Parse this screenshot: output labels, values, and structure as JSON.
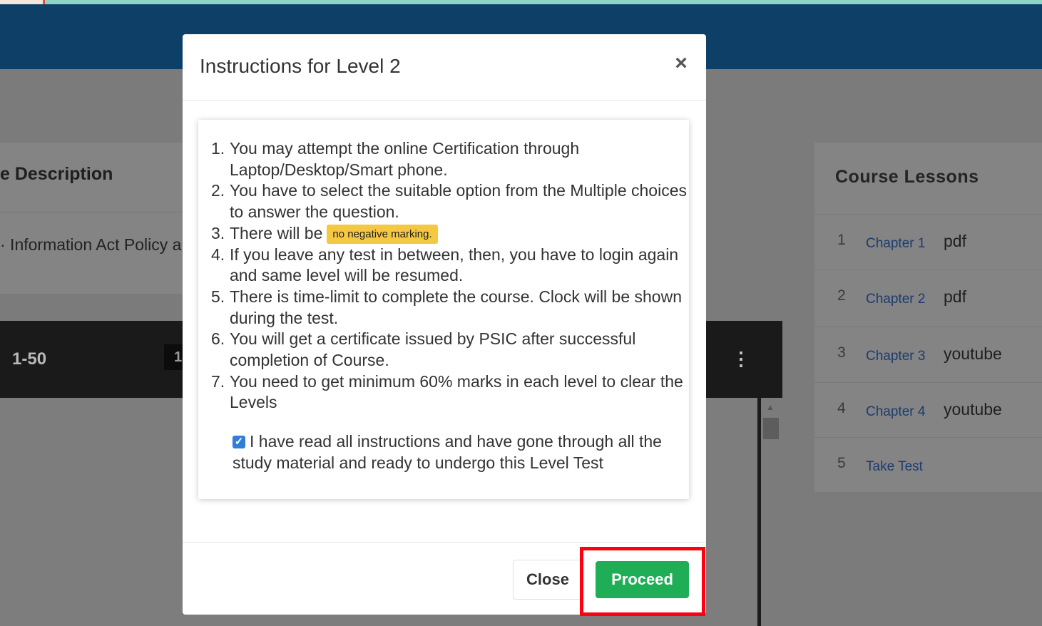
{
  "background": {
    "description_card": {
      "heading": "e Description",
      "text": "· Information Act Policy a"
    },
    "video_bar": {
      "range": "1-50",
      "pill": "1"
    },
    "lessons": {
      "heading": "Course Lessons",
      "items": [
        {
          "num": "1",
          "link": "Chapter 1",
          "type": "pdf"
        },
        {
          "num": "2",
          "link": "Chapter 2",
          "type": "pdf"
        },
        {
          "num": "3",
          "link": "Chapter 3",
          "type": "youtube"
        },
        {
          "num": "4",
          "link": "Chapter 4",
          "type": "youtube"
        },
        {
          "num": "5",
          "link": "Take Test",
          "type": ""
        }
      ]
    }
  },
  "modal": {
    "title": "Instructions for Level 2",
    "close_symbol": "×",
    "instructions": [
      {
        "num": "1.",
        "text": "You may attempt the online Certification through Laptop/Desktop/Smart phone."
      },
      {
        "num": "2.",
        "text": "You have to select the suitable option from the Multiple choices to answer the question."
      },
      {
        "num": "3.",
        "text": "There will be",
        "badge": "no negative marking."
      },
      {
        "num": "4.",
        "text": "If you leave any test in between, then, you have to login again and same level will be resumed."
      },
      {
        "num": "5.",
        "text": "There is time-limit to complete the course. Clock will be shown during the test."
      },
      {
        "num": "6.",
        "text": "You will get a certificate issued by PSIC after successful completion of Course."
      },
      {
        "num": "7.",
        "text": "You need to get minimum 60% marks in each level to clear the Levels"
      }
    ],
    "agreement": {
      "checked": true,
      "text": "I have read all instructions and have gone through all the study material and ready to undergo this Level Test"
    },
    "buttons": {
      "close": "Close",
      "proceed": "Proceed"
    }
  },
  "colors": {
    "navbar": "#0e3f66",
    "proceed": "#1fae56",
    "badge": "#f5c842",
    "highlight": "#ff0010"
  }
}
